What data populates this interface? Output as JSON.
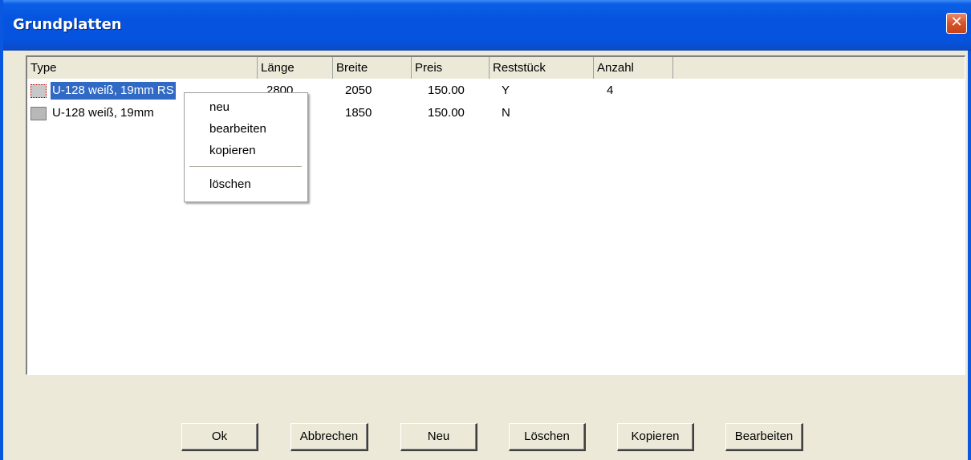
{
  "window": {
    "title": "Grundplatten",
    "close_glyph": "✕"
  },
  "listview": {
    "columns": [
      "Type",
      "Länge",
      "Breite",
      "Preis",
      "Reststück",
      "Anzahl"
    ],
    "rows": [
      {
        "type": "U-128 weiß, 19mm RS",
        "laenge": "2800",
        "breite": "2050",
        "preis": "150.00",
        "reststueck": "Y",
        "anzahl": "4",
        "selected": true
      },
      {
        "type": "U-128 weiß, 19mm",
        "laenge": "",
        "breite": "1850",
        "preis": "150.00",
        "reststueck": "N",
        "anzahl": "",
        "selected": false
      }
    ]
  },
  "context_menu": {
    "items": [
      "neu",
      "bearbeiten",
      "kopieren",
      "löschen"
    ]
  },
  "buttons": {
    "ok": "Ok",
    "cancel": "Abbrechen",
    "new": "Neu",
    "delete": "Löschen",
    "copy": "Kopieren",
    "edit": "Bearbeiten"
  },
  "icons": {
    "row_icon": "board-icon",
    "close": "close-icon"
  },
  "colors": {
    "titlebar": "#0553df",
    "selection": "#316ac5",
    "close_button": "#d9532a"
  }
}
